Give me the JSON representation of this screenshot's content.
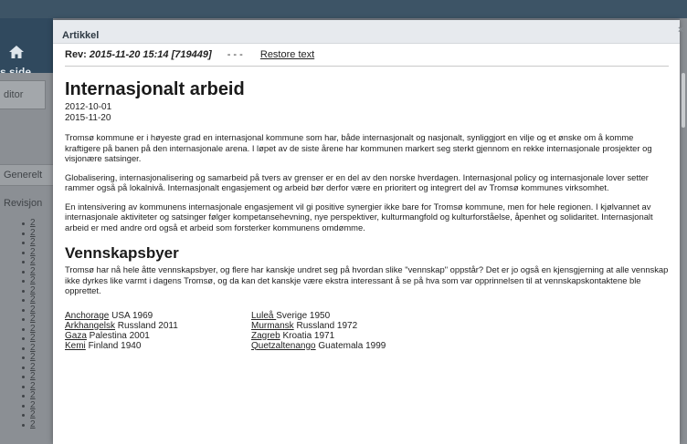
{
  "background": {
    "side_label": "s side",
    "editor_tab": "ditor",
    "generelt_tab": "Generelt",
    "revisjon_label": "Revisjon",
    "revision_items": [
      "2",
      "2",
      "2",
      "2",
      "2",
      "2",
      "2",
      "2",
      "2",
      "2",
      "2",
      "2",
      "2",
      "2",
      "2",
      "2",
      "2",
      "2",
      "2",
      "2",
      "2",
      "2"
    ]
  },
  "modal": {
    "title": "Artikkel",
    "close": "×",
    "revision": {
      "label": "Rev:",
      "value": "2015-11-20 15:14 [719449]",
      "separator": "- - -",
      "restore_link": "Restore text"
    },
    "article": {
      "title": "Internasjonalt arbeid",
      "date_created": "2012-10-01",
      "date_updated": "2015-11-20",
      "paragraphs": [
        "Tromsø kommune er i høyeste grad en internasjonal kommune som har, både internasjonalt og nasjonalt, synliggjort en vilje og et ønske om å komme kraftigere på banen på den internasjonale arena. I løpet av de siste årene har kommunen markert seg sterkt gjennom en rekke internasjonale prosjekter og visjonære satsinger.",
        "Globalisering, internasjonalisering og samarbeid på tvers av grenser er en del av den norske hverdagen. Internasjonal policy og internasjonale lover setter rammer også på lokalnivå. Internasjonalt engasjement og arbeid bør derfor være en prioritert og integrert del av Tromsø kommunes virksomhet.",
        "En intensivering av kommunens internasjonale engasjement vil gi positive synergier ikke bare for Tromsø kommune, men for hele regionen. I kjølvannet av internasjonale aktiviteter og satsinger følger kompetansehevning, nye perspektiver, kulturmangfold og kulturforståelse, åpenhet og solidaritet. Internasjonalt arbeid er med andre ord også et arbeid som forsterker kommunens omdømme."
      ],
      "section_title": "Vennskapsbyer",
      "section_paragraph": "Tromsø har nå hele åtte vennskapsbyer, og flere har kanskje undret seg på hvordan slike \"vennskap\" oppstår? Det er jo også en kjensgjerning at alle vennskap ikke dyrkes like varmt i dagens Tromsø, og da kan det kanskje være ekstra interessant å se på hva som var opprinnelsen til at vennskapskontaktene ble opprettet.",
      "cities_left": [
        {
          "name": "Anchorage",
          "info": " USA 1969"
        },
        {
          "name": "Arkhangelsk",
          "info": " Russland 2011"
        },
        {
          "name": "Gaza",
          "info": " Palestina 2001"
        },
        {
          "name": "Kemi",
          "info": " Finland 1940"
        }
      ],
      "cities_right": [
        {
          "name": "Luleå ",
          "info": "Sverige 1950"
        },
        {
          "name": "Murmansk",
          "info": " Russland 1972"
        },
        {
          "name": "Zagreb",
          "info": " Kroatia 1971"
        },
        {
          "name": "Quetzaltenango",
          "info": " Guatemala 1999"
        }
      ]
    }
  }
}
